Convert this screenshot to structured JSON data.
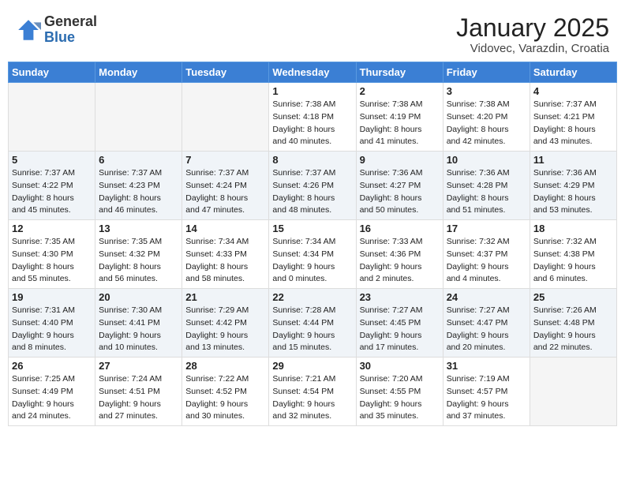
{
  "header": {
    "logo_general": "General",
    "logo_blue": "Blue",
    "month_title": "January 2025",
    "location": "Vidovec, Varazdin, Croatia"
  },
  "weekdays": [
    "Sunday",
    "Monday",
    "Tuesday",
    "Wednesday",
    "Thursday",
    "Friday",
    "Saturday"
  ],
  "weeks": [
    [
      {
        "day": "",
        "info": ""
      },
      {
        "day": "",
        "info": ""
      },
      {
        "day": "",
        "info": ""
      },
      {
        "day": "1",
        "info": "Sunrise: 7:38 AM\nSunset: 4:18 PM\nDaylight: 8 hours\nand 40 minutes."
      },
      {
        "day": "2",
        "info": "Sunrise: 7:38 AM\nSunset: 4:19 PM\nDaylight: 8 hours\nand 41 minutes."
      },
      {
        "day": "3",
        "info": "Sunrise: 7:38 AM\nSunset: 4:20 PM\nDaylight: 8 hours\nand 42 minutes."
      },
      {
        "day": "4",
        "info": "Sunrise: 7:37 AM\nSunset: 4:21 PM\nDaylight: 8 hours\nand 43 minutes."
      }
    ],
    [
      {
        "day": "5",
        "info": "Sunrise: 7:37 AM\nSunset: 4:22 PM\nDaylight: 8 hours\nand 45 minutes."
      },
      {
        "day": "6",
        "info": "Sunrise: 7:37 AM\nSunset: 4:23 PM\nDaylight: 8 hours\nand 46 minutes."
      },
      {
        "day": "7",
        "info": "Sunrise: 7:37 AM\nSunset: 4:24 PM\nDaylight: 8 hours\nand 47 minutes."
      },
      {
        "day": "8",
        "info": "Sunrise: 7:37 AM\nSunset: 4:26 PM\nDaylight: 8 hours\nand 48 minutes."
      },
      {
        "day": "9",
        "info": "Sunrise: 7:36 AM\nSunset: 4:27 PM\nDaylight: 8 hours\nand 50 minutes."
      },
      {
        "day": "10",
        "info": "Sunrise: 7:36 AM\nSunset: 4:28 PM\nDaylight: 8 hours\nand 51 minutes."
      },
      {
        "day": "11",
        "info": "Sunrise: 7:36 AM\nSunset: 4:29 PM\nDaylight: 8 hours\nand 53 minutes."
      }
    ],
    [
      {
        "day": "12",
        "info": "Sunrise: 7:35 AM\nSunset: 4:30 PM\nDaylight: 8 hours\nand 55 minutes."
      },
      {
        "day": "13",
        "info": "Sunrise: 7:35 AM\nSunset: 4:32 PM\nDaylight: 8 hours\nand 56 minutes."
      },
      {
        "day": "14",
        "info": "Sunrise: 7:34 AM\nSunset: 4:33 PM\nDaylight: 8 hours\nand 58 minutes."
      },
      {
        "day": "15",
        "info": "Sunrise: 7:34 AM\nSunset: 4:34 PM\nDaylight: 9 hours\nand 0 minutes."
      },
      {
        "day": "16",
        "info": "Sunrise: 7:33 AM\nSunset: 4:36 PM\nDaylight: 9 hours\nand 2 minutes."
      },
      {
        "day": "17",
        "info": "Sunrise: 7:32 AM\nSunset: 4:37 PM\nDaylight: 9 hours\nand 4 minutes."
      },
      {
        "day": "18",
        "info": "Sunrise: 7:32 AM\nSunset: 4:38 PM\nDaylight: 9 hours\nand 6 minutes."
      }
    ],
    [
      {
        "day": "19",
        "info": "Sunrise: 7:31 AM\nSunset: 4:40 PM\nDaylight: 9 hours\nand 8 minutes."
      },
      {
        "day": "20",
        "info": "Sunrise: 7:30 AM\nSunset: 4:41 PM\nDaylight: 9 hours\nand 10 minutes."
      },
      {
        "day": "21",
        "info": "Sunrise: 7:29 AM\nSunset: 4:42 PM\nDaylight: 9 hours\nand 13 minutes."
      },
      {
        "day": "22",
        "info": "Sunrise: 7:28 AM\nSunset: 4:44 PM\nDaylight: 9 hours\nand 15 minutes."
      },
      {
        "day": "23",
        "info": "Sunrise: 7:27 AM\nSunset: 4:45 PM\nDaylight: 9 hours\nand 17 minutes."
      },
      {
        "day": "24",
        "info": "Sunrise: 7:27 AM\nSunset: 4:47 PM\nDaylight: 9 hours\nand 20 minutes."
      },
      {
        "day": "25",
        "info": "Sunrise: 7:26 AM\nSunset: 4:48 PM\nDaylight: 9 hours\nand 22 minutes."
      }
    ],
    [
      {
        "day": "26",
        "info": "Sunrise: 7:25 AM\nSunset: 4:49 PM\nDaylight: 9 hours\nand 24 minutes."
      },
      {
        "day": "27",
        "info": "Sunrise: 7:24 AM\nSunset: 4:51 PM\nDaylight: 9 hours\nand 27 minutes."
      },
      {
        "day": "28",
        "info": "Sunrise: 7:22 AM\nSunset: 4:52 PM\nDaylight: 9 hours\nand 30 minutes."
      },
      {
        "day": "29",
        "info": "Sunrise: 7:21 AM\nSunset: 4:54 PM\nDaylight: 9 hours\nand 32 minutes."
      },
      {
        "day": "30",
        "info": "Sunrise: 7:20 AM\nSunset: 4:55 PM\nDaylight: 9 hours\nand 35 minutes."
      },
      {
        "day": "31",
        "info": "Sunrise: 7:19 AM\nSunset: 4:57 PM\nDaylight: 9 hours\nand 37 minutes."
      },
      {
        "day": "",
        "info": ""
      }
    ]
  ]
}
